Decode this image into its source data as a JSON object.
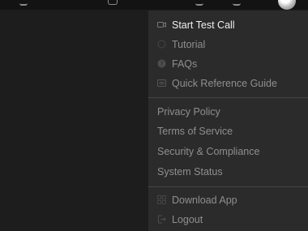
{
  "icons": {
    "start_test_call": "video-camera-icon",
    "tutorial": "circle-icon",
    "faqs": "question-circle-icon",
    "quick_reference": "book-icon",
    "download": "grid-icon",
    "logout": "logout-icon"
  },
  "menu": {
    "section1": [
      {
        "label": "Start Test Call"
      },
      {
        "label": "Tutorial"
      },
      {
        "label": "FAQs"
      },
      {
        "label": "Quick Reference Guide"
      }
    ],
    "section2": [
      {
        "label": "Privacy Policy"
      },
      {
        "label": "Terms of Service"
      },
      {
        "label": "Security & Compliance"
      },
      {
        "label": "System Status"
      }
    ],
    "section3": [
      {
        "label": "Download App"
      },
      {
        "label": "Logout"
      }
    ]
  }
}
